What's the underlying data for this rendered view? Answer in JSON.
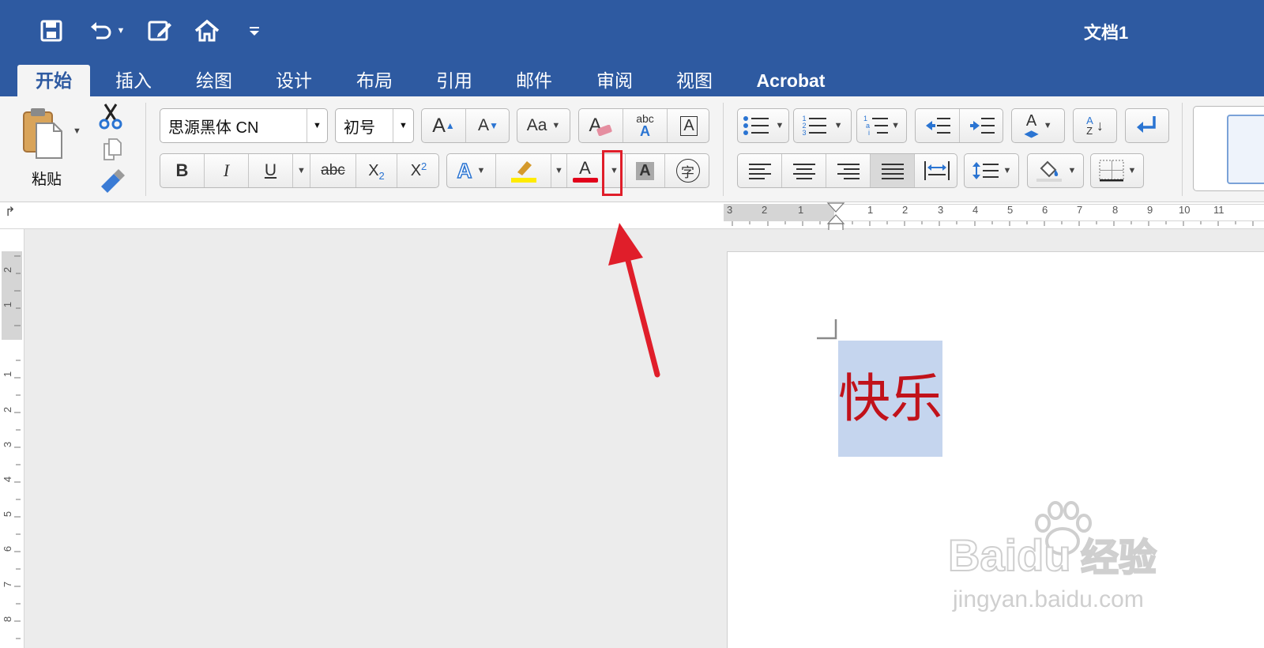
{
  "window": {
    "title": "文档1"
  },
  "quick_access": {
    "icons": [
      "save-icon",
      "undo-icon",
      "edit-icon",
      "home-icon",
      "customize-icon"
    ]
  },
  "tabs": [
    {
      "label": "开始",
      "active": true
    },
    {
      "label": "插入"
    },
    {
      "label": "绘图"
    },
    {
      "label": "设计"
    },
    {
      "label": "布局"
    },
    {
      "label": "引用"
    },
    {
      "label": "邮件"
    },
    {
      "label": "审阅"
    },
    {
      "label": "视图"
    },
    {
      "label": "Acrobat"
    }
  ],
  "clipboard": {
    "paste_label": "粘贴"
  },
  "font": {
    "name": "思源黑体 CN",
    "size": "初号",
    "bold_label": "B",
    "italic_label": "I",
    "underline_label": "U",
    "strike_label": "abc",
    "subscript_label": "X",
    "subscript_mark": "2",
    "superscript_label": "X",
    "superscript_mark": "2",
    "grow_label": "A",
    "shrink_label": "A",
    "case_label": "Aa",
    "clear_label": "A",
    "phonetic_top": "abc",
    "phonetic_bottom": "A",
    "border_label": "A",
    "effects_label": "A",
    "color_label": "A",
    "shading_label": "A",
    "enclose_label": "字",
    "color_accent": "#e2001a",
    "highlight_accent": "#ffeb00"
  },
  "paragraph": {
    "sort_top": "A",
    "sort_bottom": "Z",
    "numbering_digits": [
      "1",
      "2",
      "3"
    ],
    "multilevel_marks": [
      "1",
      "a",
      "i"
    ]
  },
  "ruler": {
    "h_numbers": [
      "3",
      "2",
      "1",
      "1",
      "2",
      "3",
      "4",
      "5",
      "6",
      "7",
      "8",
      "9",
      "10",
      "11"
    ],
    "v_numbers": [
      "2",
      "1",
      "1",
      "2",
      "3",
      "4",
      "5",
      "6",
      "7",
      "8"
    ]
  },
  "document": {
    "selected_text": "快乐",
    "text_color": "#c1121a",
    "selection_color": "#c5d5ee"
  },
  "annotation": {
    "highlight_color": "#e01e2a"
  },
  "watermark": {
    "brand": "Baidu",
    "product": "经验",
    "url": "jingyan.baidu.com"
  }
}
